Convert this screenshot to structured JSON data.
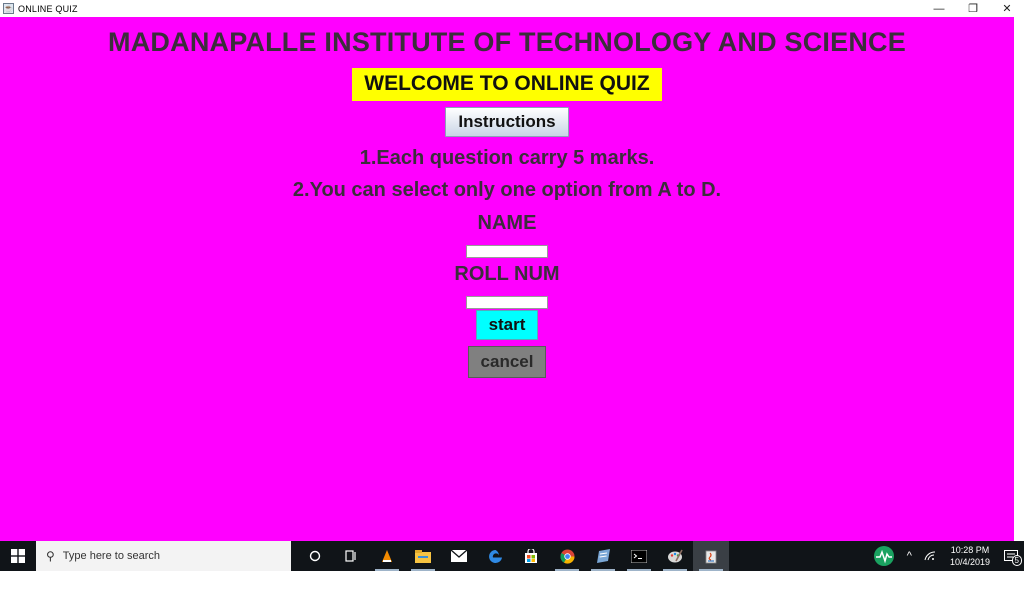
{
  "window": {
    "title": "ONLINE QUIZ",
    "minimize": "—",
    "restore": "❐",
    "close": "✕"
  },
  "colors": {
    "background": "#ff00ff",
    "welcome_bg": "#ffff00",
    "start_bg": "#00ffff",
    "cancel_bg": "#808080"
  },
  "page": {
    "heading": "MADANAPALLE INSTITUTE OF TECHNOLOGY AND SCIENCE",
    "welcome": "WELCOME TO ONLINE QUIZ",
    "instructions_label": "Instructions",
    "rule1": "1.Each question carry 5 marks.",
    "rule2": "2.You can select only one option from A to D.",
    "name_label": "NAME",
    "name_value": "",
    "roll_label": "ROLL NUM",
    "roll_value": "",
    "start_label": "start",
    "cancel_label": "cancel"
  },
  "taskbar": {
    "search_placeholder": "Type here to search",
    "icons": [
      "cortana-icon",
      "task-view-icon",
      "vlc-icon",
      "file-explorer-icon",
      "mail-icon",
      "edge-icon",
      "store-icon",
      "chrome-icon",
      "notepad-icon",
      "terminal-icon",
      "paint-icon",
      "java-icon"
    ],
    "time": "10:28 PM",
    "date": "10/4/2019",
    "notification_count": "5"
  }
}
